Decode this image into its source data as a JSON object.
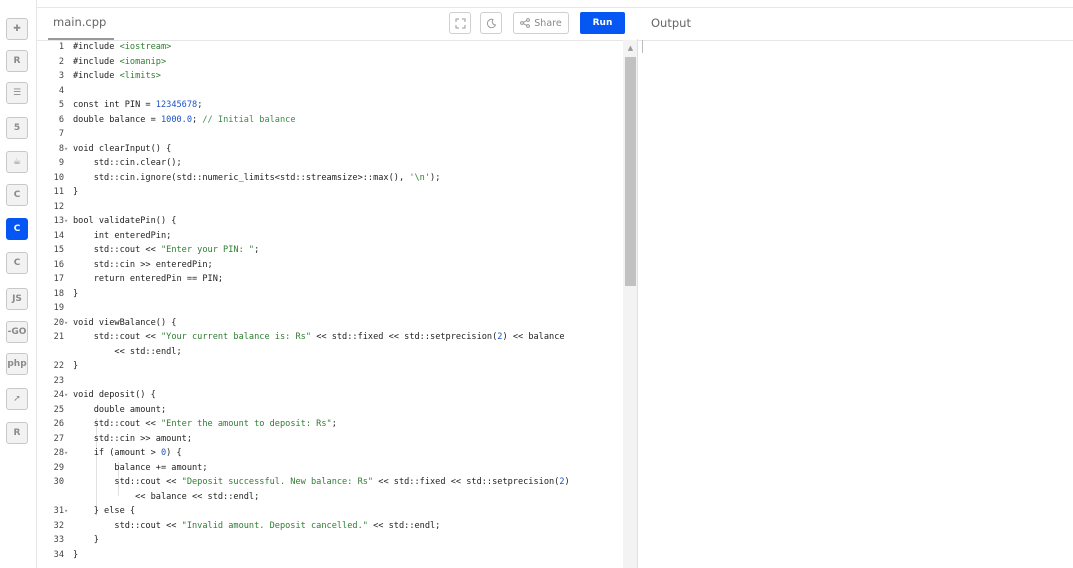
{
  "tab": {
    "label": "main.cpp"
  },
  "toolbar": {
    "share_label": "Share",
    "run_label": "Run"
  },
  "output": {
    "label": "Output"
  },
  "languages": [
    {
      "name": "python-icon",
      "glyph": "✚",
      "active": false
    },
    {
      "name": "r-icon",
      "glyph": "R",
      "active": false
    },
    {
      "name": "sql-icon",
      "glyph": "☰",
      "active": false
    },
    {
      "name": "html5-icon",
      "glyph": "5",
      "active": false
    },
    {
      "name": "java-icon",
      "glyph": "☕",
      "active": false
    },
    {
      "name": "c-icon",
      "glyph": "C",
      "active": false
    },
    {
      "name": "cpp-icon",
      "glyph": "C",
      "active": true
    },
    {
      "name": "csharp-icon",
      "glyph": "C",
      "active": false
    },
    {
      "name": "js-icon",
      "glyph": "JS",
      "active": false
    },
    {
      "name": "go-icon",
      "glyph": "-GO",
      "active": false
    },
    {
      "name": "php-icon",
      "glyph": "php",
      "active": false
    },
    {
      "name": "swift-icon",
      "glyph": "➚",
      "active": false
    },
    {
      "name": "rust-icon",
      "glyph": "R",
      "active": false
    }
  ],
  "code": [
    {
      "n": "1",
      "fold": false,
      "segs": [
        [
          "",
          "#include "
        ],
        [
          "str",
          "<iostream>"
        ]
      ]
    },
    {
      "n": "2",
      "fold": false,
      "segs": [
        [
          "",
          "#include "
        ],
        [
          "str",
          "<iomanip>"
        ]
      ]
    },
    {
      "n": "3",
      "fold": false,
      "segs": [
        [
          "",
          "#include "
        ],
        [
          "str",
          "<limits>"
        ]
      ]
    },
    {
      "n": "4",
      "fold": false,
      "segs": []
    },
    {
      "n": "5",
      "fold": false,
      "segs": [
        [
          "",
          "const int PIN = "
        ],
        [
          "num",
          "12345678"
        ],
        [
          "",
          ";"
        ]
      ]
    },
    {
      "n": "6",
      "fold": false,
      "segs": [
        [
          "",
          "double balance = "
        ],
        [
          "num",
          "1000.0"
        ],
        [
          "",
          "; "
        ],
        [
          "cmt",
          "// Initial balance"
        ]
      ]
    },
    {
      "n": "7",
      "fold": false,
      "segs": []
    },
    {
      "n": "8",
      "fold": true,
      "segs": [
        [
          "",
          "void clearInput() {"
        ]
      ]
    },
    {
      "n": "9",
      "fold": false,
      "segs": [
        [
          "",
          "    std::cin.clear();"
        ]
      ]
    },
    {
      "n": "10",
      "fold": false,
      "segs": [
        [
          "",
          "    std::cin.ignore(std::numeric_limits<std::streamsize>::max(), "
        ],
        [
          "str",
          "'\\n'"
        ],
        [
          "",
          ");"
        ]
      ]
    },
    {
      "n": "11",
      "fold": false,
      "segs": [
        [
          "",
          "}"
        ]
      ]
    },
    {
      "n": "12",
      "fold": false,
      "segs": []
    },
    {
      "n": "13",
      "fold": true,
      "segs": [
        [
          "",
          "bool validatePin() {"
        ]
      ]
    },
    {
      "n": "14",
      "fold": false,
      "segs": [
        [
          "",
          "    int enteredPin;"
        ]
      ]
    },
    {
      "n": "15",
      "fold": false,
      "segs": [
        [
          "",
          "    std::cout << "
        ],
        [
          "str",
          "\"Enter your PIN: \""
        ],
        [
          "",
          ";"
        ]
      ]
    },
    {
      "n": "16",
      "fold": false,
      "segs": [
        [
          "",
          "    std::cin >> enteredPin;"
        ]
      ]
    },
    {
      "n": "17",
      "fold": false,
      "segs": [
        [
          "",
          "    return enteredPin == PIN;"
        ]
      ]
    },
    {
      "n": "18",
      "fold": false,
      "segs": [
        [
          "",
          "}"
        ]
      ]
    },
    {
      "n": "19",
      "fold": false,
      "segs": []
    },
    {
      "n": "20",
      "fold": true,
      "segs": [
        [
          "",
          "void viewBalance() {"
        ]
      ]
    },
    {
      "n": "21",
      "fold": false,
      "segs": [
        [
          "",
          "    std::cout << "
        ],
        [
          "str",
          "\"Your current balance is: Rs\""
        ],
        [
          "",
          " << std::fixed << std::setprecision("
        ],
        [
          "num",
          "2"
        ],
        [
          "",
          ") << balance"
        ]
      ]
    },
    {
      "n": "",
      "fold": false,
      "segs": [
        [
          "",
          "        << std::endl;"
        ]
      ]
    },
    {
      "n": "22",
      "fold": false,
      "segs": [
        [
          "",
          "}"
        ]
      ]
    },
    {
      "n": "23",
      "fold": false,
      "segs": []
    },
    {
      "n": "24",
      "fold": true,
      "segs": [
        [
          "",
          "void deposit() {"
        ]
      ]
    },
    {
      "n": "25",
      "fold": false,
      "segs": [
        [
          "",
          "    double amount;"
        ]
      ]
    },
    {
      "n": "26",
      "fold": false,
      "segs": [
        [
          "",
          "    std::cout << "
        ],
        [
          "str",
          "\"Enter the amount to deposit: Rs\""
        ],
        [
          "",
          ";"
        ]
      ]
    },
    {
      "n": "27",
      "fold": false,
      "segs": [
        [
          "",
          "    std::cin >> amount;"
        ]
      ]
    },
    {
      "n": "28",
      "fold": true,
      "segs": [
        [
          "",
          "    if (amount > "
        ],
        [
          "num",
          "0"
        ],
        [
          "",
          ") {"
        ]
      ]
    },
    {
      "n": "29",
      "fold": false,
      "segs": [
        [
          "",
          "        balance += amount;"
        ]
      ]
    },
    {
      "n": "30",
      "fold": false,
      "segs": [
        [
          "",
          "        std::cout << "
        ],
        [
          "str",
          "\"Deposit successful. New balance: Rs\""
        ],
        [
          "",
          " << std::fixed << std::setprecision("
        ],
        [
          "num",
          "2"
        ],
        [
          "",
          ")"
        ]
      ]
    },
    {
      "n": "",
      "fold": false,
      "segs": [
        [
          "",
          "            << balance << std::endl;"
        ]
      ]
    },
    {
      "n": "31",
      "fold": true,
      "segs": [
        [
          "",
          "    } else {"
        ]
      ]
    },
    {
      "n": "32",
      "fold": false,
      "segs": [
        [
          "",
          "        std::cout << "
        ],
        [
          "str",
          "\"Invalid amount. Deposit cancelled.\""
        ],
        [
          "",
          " << std::endl;"
        ]
      ]
    },
    {
      "n": "33",
      "fold": false,
      "segs": [
        [
          "",
          "    }"
        ]
      ]
    },
    {
      "n": "34",
      "fold": false,
      "segs": [
        [
          "",
          "}"
        ]
      ]
    }
  ]
}
